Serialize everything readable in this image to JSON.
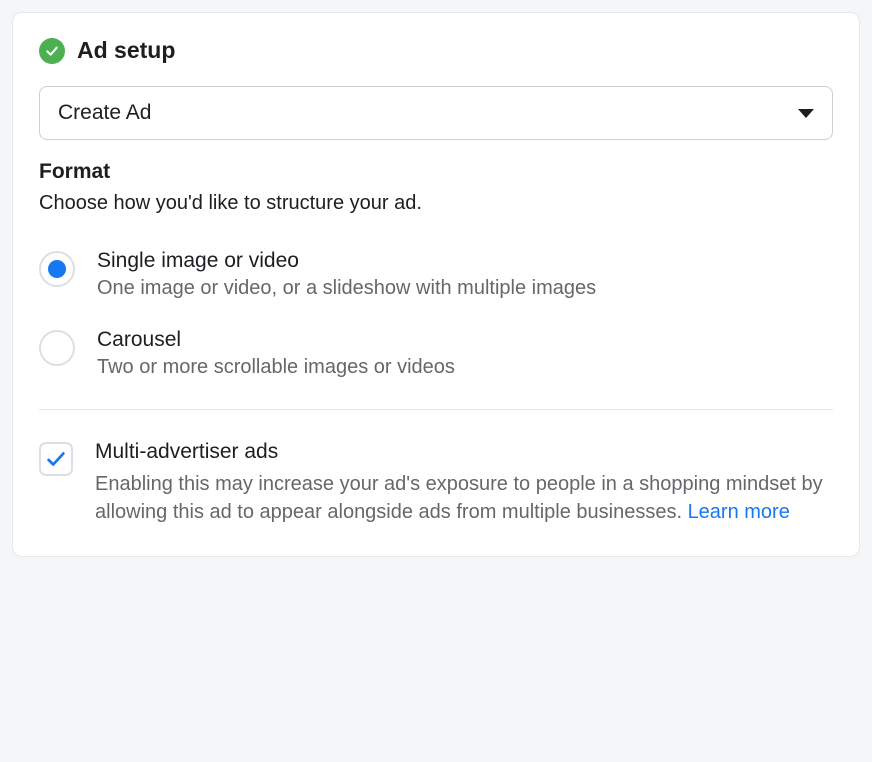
{
  "header": {
    "title": "Ad setup",
    "status_icon": "check-circle"
  },
  "dropdown": {
    "selected": "Create Ad"
  },
  "format": {
    "heading": "Format",
    "subtext": "Choose how you'd like to structure your ad.",
    "options": [
      {
        "label": "Single image or video",
        "description": "One image or video, or a slideshow with multiple images",
        "selected": true
      },
      {
        "label": "Carousel",
        "description": "Two or more scrollable images or videos",
        "selected": false
      }
    ]
  },
  "multi_advertiser": {
    "label": "Multi-advertiser ads",
    "description": "Enabling this may increase your ad's exposure to people in a shopping mindset by allowing this ad to appear alongside ads from multiple businesses. ",
    "link_text": "Learn more",
    "checked": true
  },
  "colors": {
    "success": "#4caf50",
    "primary": "#1877f2",
    "text": "#1c1e21",
    "muted": "#65676b"
  }
}
